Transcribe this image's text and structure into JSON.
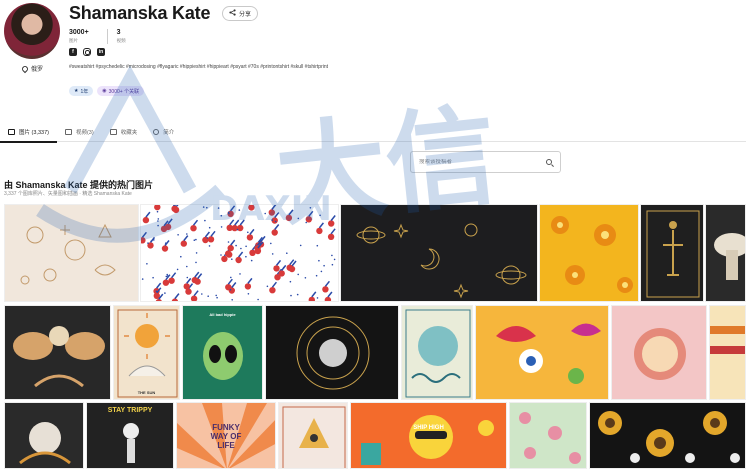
{
  "profile": {
    "name": "Shamanska Kate",
    "share_label": "分享",
    "location_label": "俄罗",
    "stats": [
      {
        "value": "3000+",
        "label": "图片"
      },
      {
        "value": "3",
        "label": "视频"
      }
    ],
    "tags": "#sweatshirt #psychedelic #microdosing #flyagaric #hippieshirt #hippieart #psyart #70s #printontshirt #skull #tshirtprint",
    "badges": [
      {
        "icon": "star-icon",
        "label": "1年"
      },
      {
        "icon": "image-icon",
        "label": "3000+ 个关联"
      }
    ]
  },
  "tabs": [
    {
      "icon": "image-icon",
      "label": "图片 (3,337)",
      "active": true
    },
    {
      "icon": "video-icon",
      "label": "视频(3)",
      "active": false
    },
    {
      "icon": "folder-icon",
      "label": "收藏夹",
      "active": false
    },
    {
      "icon": "person-icon",
      "label": "简介",
      "active": false
    }
  ],
  "search": {
    "placeholder": "搜索该投稿者"
  },
  "section": {
    "title": "由 Shamanska Kate 提供的热门图片",
    "subtitle": "3,337 个图库照片、矢量图和插画 · 精选 Shamanska Kate"
  },
  "gallery": {
    "row2": {
      "tarot_label": "THE SUN",
      "alien_text": "All bad hippie"
    },
    "row3": {
      "stay_trippy": "STAY TRIPPY",
      "funky": "FUNKY WAY OF LIFE",
      "ship_high": "SHIP HIGH"
    }
  },
  "watermark": {
    "text": "大信",
    "subtext": "DAXIN"
  },
  "colors": {
    "accent": "#1a1a1a",
    "badge_blue": "#dfeaf8",
    "badge_purple": "#ece3fb",
    "watermark": "#1f5fb0"
  }
}
